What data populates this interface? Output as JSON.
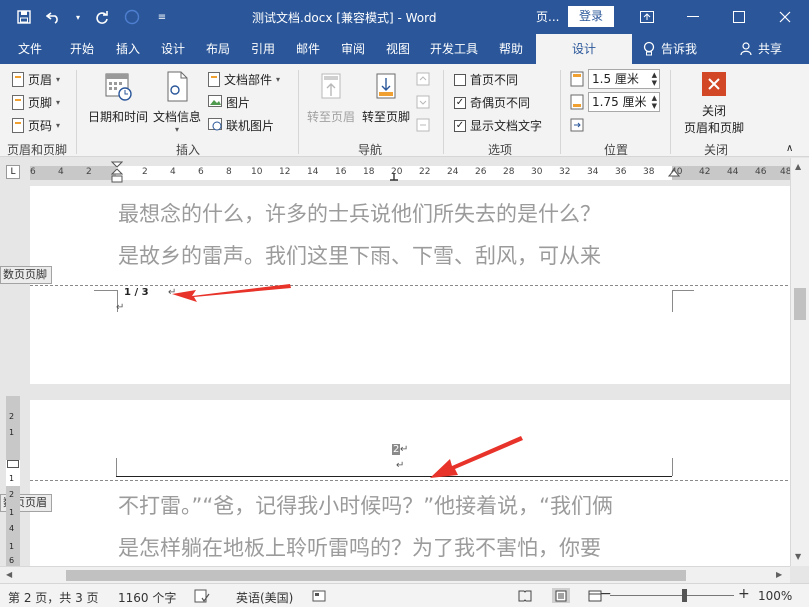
{
  "titlebar": {
    "doc_title": "测试文档.docx [兼容模式]  -  Word",
    "context_tab": "页...",
    "login": "登录"
  },
  "tabs": [
    "文件",
    "开始",
    "插入",
    "设计",
    "布局",
    "引用",
    "邮件",
    "审阅",
    "视图",
    "开发工具",
    "帮助",
    "设计"
  ],
  "tell_me": "告诉我",
  "share": "共享",
  "ribbon": {
    "header_footer": {
      "items": [
        "页眉",
        "页脚",
        "页码"
      ],
      "label": "页眉和页脚"
    },
    "insert": {
      "datetime": "日期和时间",
      "docinfo": "文档信息",
      "docparts": "文档部件",
      "picture": "图片",
      "online_picture": "联机图片",
      "label": "插入"
    },
    "navigation": {
      "goto_header": "转至页眉",
      "goto_footer": "转至页脚",
      "label": "导航"
    },
    "options": {
      "first_page": "首页不同",
      "odd_even": "奇偶页不同",
      "show_text": "显示文档文字",
      "first_page_checked": false,
      "odd_even_checked": true,
      "show_text_checked": true,
      "label": "选项"
    },
    "position": {
      "header_dist": "1.5 厘米",
      "footer_dist": "1.75 厘米",
      "label": "位置"
    },
    "close": {
      "button": "关闭\n页眉和页脚",
      "button_line1": "关闭",
      "button_line2": "页眉和页脚",
      "label": "关闭"
    }
  },
  "ruler": {
    "corner": "L",
    "ticks": [
      "6",
      "4",
      "2",
      "2",
      "4",
      "6",
      "8",
      "10",
      "12",
      "14",
      "16",
      "18",
      "20",
      "22",
      "24",
      "26",
      "28",
      "30",
      "32",
      "34",
      "36",
      "38",
      "40",
      "42",
      "44",
      "46",
      "48"
    ],
    "vticks": [
      "2",
      "1",
      "1",
      "2",
      "1",
      "4",
      "1",
      "6"
    ]
  },
  "document": {
    "line1": "最想念的什么，许多的士兵说他们所失去的是什么？",
    "line2": "是故乡的雷声。我们这里下雨、下雪、刮风，可从来",
    "footer_tag": "奇数页页脚",
    "footer_tag_visible": "数页页脚",
    "page_number_field": "1 / 3",
    "header_tag": "偶数页页眉",
    "header_tag_visible": "数页页眉",
    "header_number": "2",
    "line3": "不打雷。”“爸，记得我小时候吗？”他接着说，“我们俩",
    "line4": "是怎样躺在地板上聆听雷鸣的？为了我不害怕，你要"
  },
  "status": {
    "page": "第 2 页，共 3 页",
    "words": "1160 个字",
    "language": "英语(美国)",
    "zoom": "100%"
  },
  "colors": {
    "brand": "#2b579a",
    "arrow": "#e8332a"
  }
}
